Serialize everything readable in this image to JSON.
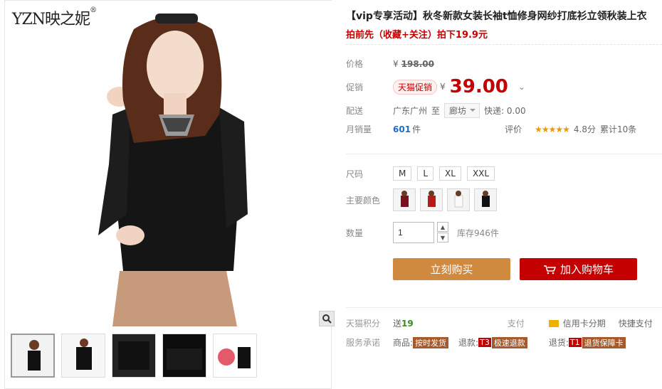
{
  "brand": {
    "name": "YZN映之妮",
    "trademark": "®"
  },
  "product": {
    "title": "【vip专享活动】秋冬新款女装长袖t恤修身网纱打底衫立领秋装上衣",
    "promo": "拍前先（收藏+关注）拍下19.9元"
  },
  "price": {
    "label": "价格",
    "currency": "¥",
    "original": "198.00",
    "promo_label": "促销",
    "promo_tag": "天猫促销",
    "current": "39.00"
  },
  "delivery": {
    "label": "配送",
    "from": "广东广州",
    "to_word": "至",
    "destination": "廊坊",
    "fee_label": "快递: 0.00"
  },
  "sales": {
    "label": "月销量",
    "count": "601",
    "unit": "件",
    "rating_label": "评价",
    "stars": "★★★★★",
    "score": "4.8分",
    "total": "累计10条"
  },
  "size": {
    "label": "尺码",
    "options": [
      "M",
      "L",
      "XL",
      "XXL"
    ]
  },
  "color": {
    "label": "主要颜色",
    "options": [
      "dark-red-top",
      "red-top",
      "white-top",
      "black-top"
    ]
  },
  "quantity": {
    "label": "数量",
    "value": "1",
    "stock": "库存946件"
  },
  "buttons": {
    "buy": "立刻购买",
    "cart": "加入购物车"
  },
  "footer": {
    "points_label": "天猫积分",
    "points_prefix": "送",
    "points_value": "19",
    "pay_label": "支付",
    "credit": "信用卡分期",
    "fast_pay": "快捷支付",
    "service_label": "服务承诺",
    "goods_label": "商品:",
    "goods_badge": "按时发货",
    "refund_label": "退款:",
    "refund_code": "T3",
    "refund_badge": "极速退款",
    "return_label": "退货:",
    "return_code": "T1",
    "return_badge": "退货保障卡"
  },
  "colors": {
    "accent": "#c40000",
    "buy": "#cf8a40",
    "link": "#1f6cc4"
  }
}
